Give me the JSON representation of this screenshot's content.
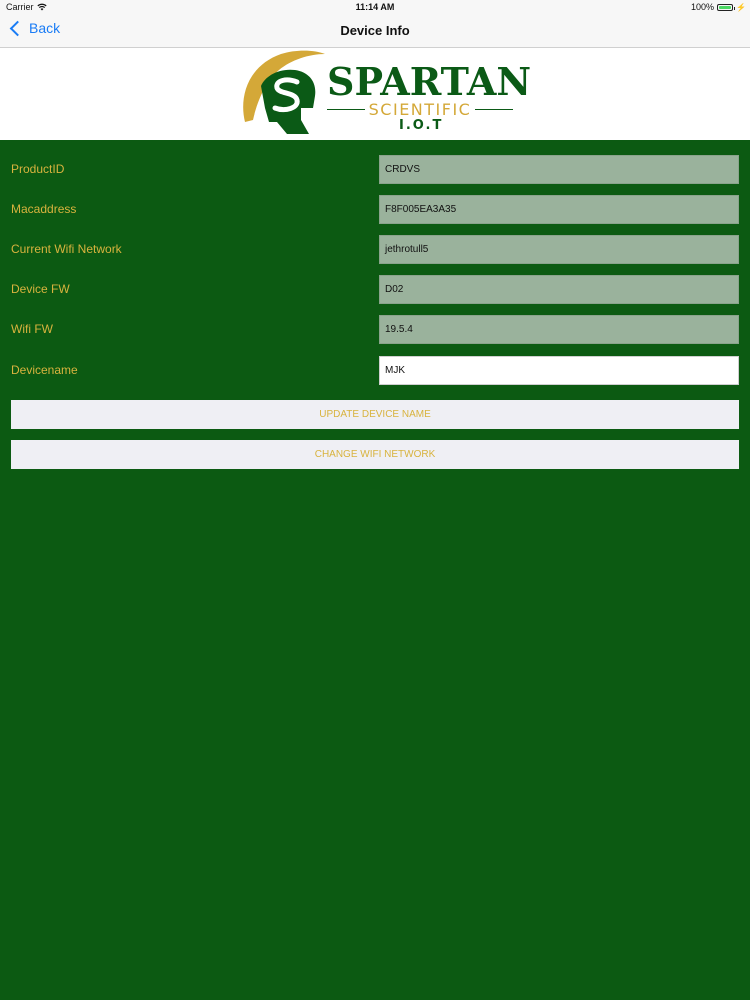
{
  "status_bar": {
    "carrier": "Carrier",
    "wifi_icon": "wifi-icon",
    "time": "11:14 AM",
    "battery_percent": "100%",
    "battery_level": 1.0,
    "battery_color": "#4cd964"
  },
  "nav": {
    "back_label": "Back",
    "title": "Device Info",
    "accent": "#1a7cf5"
  },
  "logo": {
    "wordmark": "SPARTAN",
    "subtitle": "SCIENTIFIC",
    "tagline": "I.O.T",
    "brand_green": "#0b5a16",
    "brand_gold": "#d4a838"
  },
  "fields": [
    {
      "label": "ProductID",
      "value": "CRDVS",
      "editable": false
    },
    {
      "label": "Macaddress",
      "value": "F8F005EA3A35",
      "editable": false
    },
    {
      "label": "Current Wifi Network",
      "value": "jethrotull5",
      "editable": false
    },
    {
      "label": "Device FW",
      "value": "D02",
      "editable": false
    },
    {
      "label": "Wifi FW",
      "value": "19.5.4",
      "editable": false
    },
    {
      "label": "Devicename",
      "value": "MJK",
      "editable": true
    }
  ],
  "buttons": {
    "update_device_name": "UPDATE DEVICE NAME",
    "change_wifi_network": "CHANGE WIFI NETWORK"
  },
  "colors": {
    "background": "#0c5a12",
    "label_gold": "#d8b33e",
    "readonly_field": "#9ab29c"
  }
}
